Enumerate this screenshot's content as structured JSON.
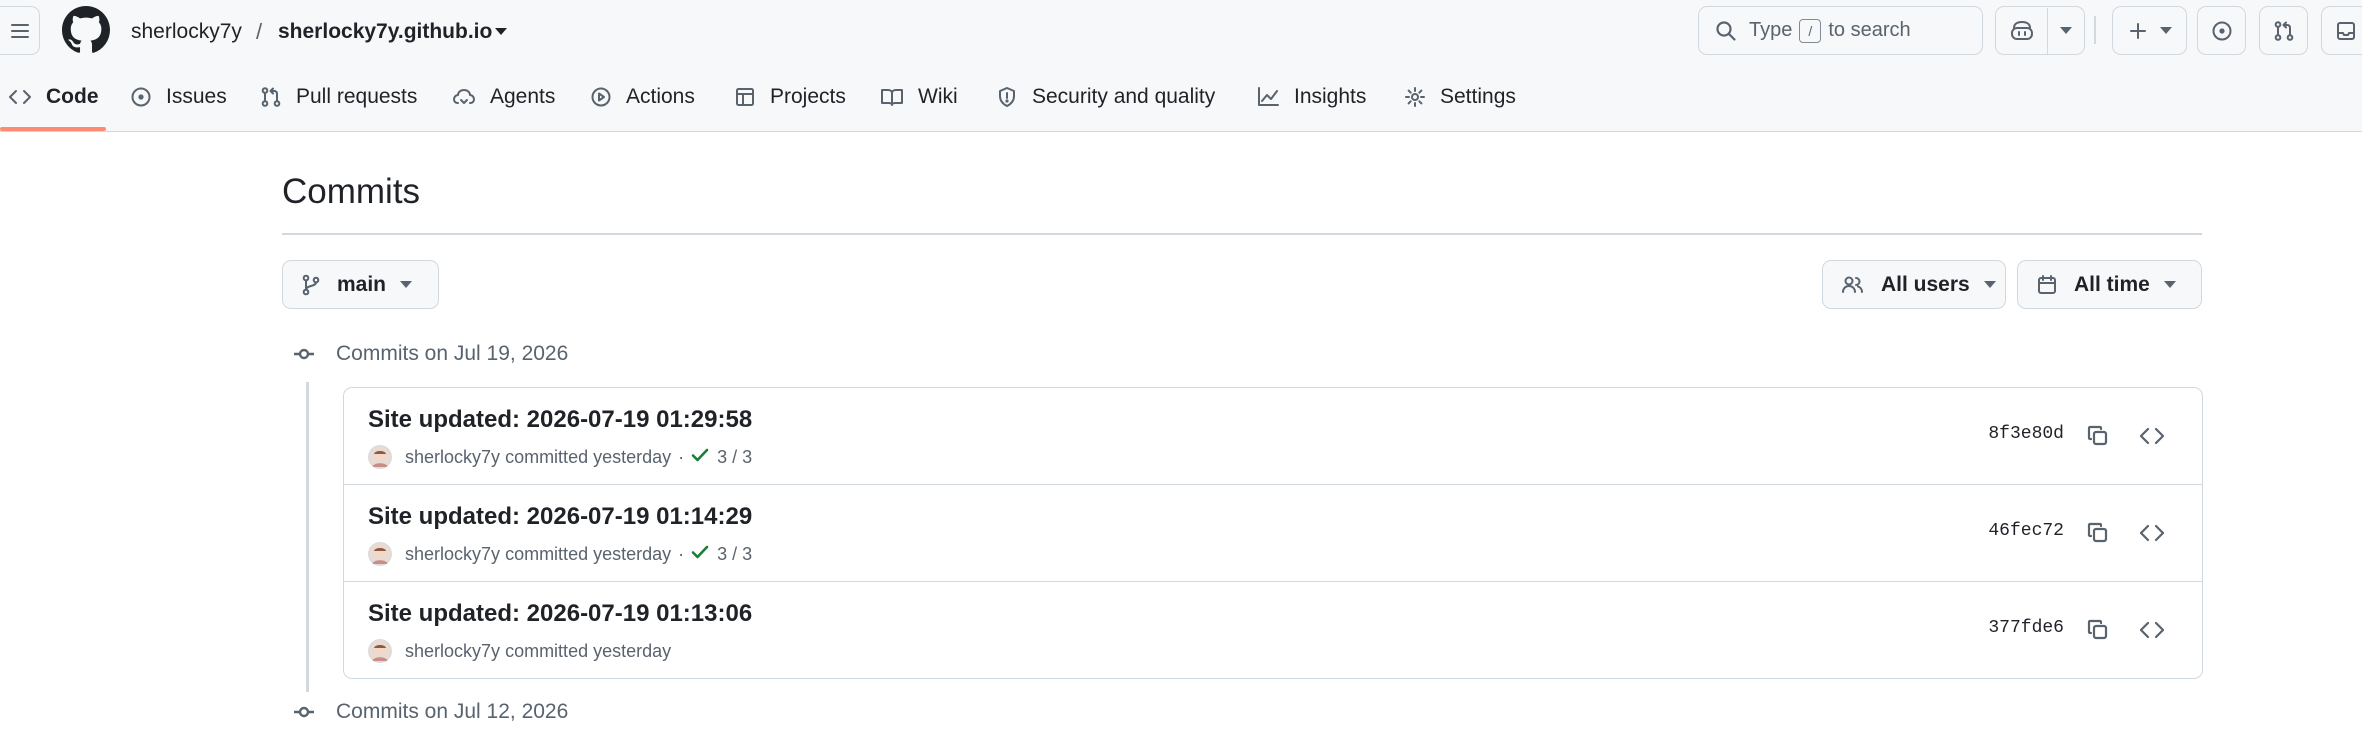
{
  "header": {
    "owner": "sherlocky7y",
    "separator": "/",
    "repo": "sherlocky7y.github.io",
    "search": {
      "prefix": "Type",
      "key": "/",
      "suffix": "to search"
    }
  },
  "tabs": [
    {
      "label": "Code",
      "icon": "code-icon"
    },
    {
      "label": "Issues",
      "icon": "issue-icon"
    },
    {
      "label": "Pull requests",
      "icon": "pull-request-icon"
    },
    {
      "label": "Agents",
      "icon": "agents-icon"
    },
    {
      "label": "Actions",
      "icon": "play-icon"
    },
    {
      "label": "Projects",
      "icon": "table-icon"
    },
    {
      "label": "Wiki",
      "icon": "book-icon"
    },
    {
      "label": "Security and quality",
      "icon": "shield-icon"
    },
    {
      "label": "Insights",
      "icon": "graph-icon"
    },
    {
      "label": "Settings",
      "icon": "gear-icon"
    }
  ],
  "page": {
    "title": "Commits",
    "branch": "main",
    "users_filter": "All users",
    "time_filter": "All time"
  },
  "groups": [
    {
      "heading": "Commits on Jul 19, 2026",
      "commits": [
        {
          "title": "Site updated: 2026-07-19 01:29:58",
          "author": "sherlocky7y",
          "action": "committed",
          "when": "yesterday",
          "dot": "·",
          "checks": "3 / 3",
          "sha": "8f3e80d"
        },
        {
          "title": "Site updated: 2026-07-19 01:14:29",
          "author": "sherlocky7y",
          "action": "committed",
          "when": "yesterday",
          "dot": "·",
          "checks": "3 / 3",
          "sha": "46fec72"
        },
        {
          "title": "Site updated: 2026-07-19 01:13:06",
          "author": "sherlocky7y",
          "action": "committed",
          "when": "yesterday",
          "sha": "377fde6"
        }
      ]
    },
    {
      "heading": "Commits on Jul 12, 2026"
    }
  ],
  "colors": {
    "accent_underline": "#fd8c73",
    "success": "#1a7f37",
    "border": "#d1d9e0",
    "header_bg": "#f6f8fa"
  }
}
